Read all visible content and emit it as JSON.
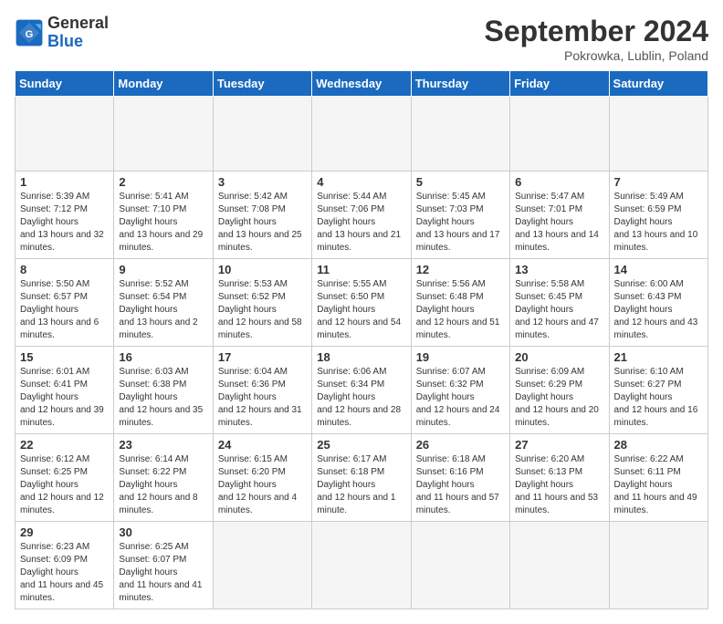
{
  "header": {
    "logo_general": "General",
    "logo_blue": "Blue",
    "month_title": "September 2024",
    "location": "Pokrowka, Lublin, Poland"
  },
  "calendar": {
    "days_of_week": [
      "Sunday",
      "Monday",
      "Tuesday",
      "Wednesday",
      "Thursday",
      "Friday",
      "Saturday"
    ],
    "weeks": [
      [
        {
          "day": "",
          "empty": true
        },
        {
          "day": "",
          "empty": true
        },
        {
          "day": "",
          "empty": true
        },
        {
          "day": "",
          "empty": true
        },
        {
          "day": "",
          "empty": true
        },
        {
          "day": "",
          "empty": true
        },
        {
          "day": "",
          "empty": true
        }
      ],
      [
        {
          "day": "1",
          "sunrise": "5:39 AM",
          "sunset": "7:12 PM",
          "daylight": "13 hours and 32 minutes."
        },
        {
          "day": "2",
          "sunrise": "5:41 AM",
          "sunset": "7:10 PM",
          "daylight": "13 hours and 29 minutes."
        },
        {
          "day": "3",
          "sunrise": "5:42 AM",
          "sunset": "7:08 PM",
          "daylight": "13 hours and 25 minutes."
        },
        {
          "day": "4",
          "sunrise": "5:44 AM",
          "sunset": "7:06 PM",
          "daylight": "13 hours and 21 minutes."
        },
        {
          "day": "5",
          "sunrise": "5:45 AM",
          "sunset": "7:03 PM",
          "daylight": "13 hours and 17 minutes."
        },
        {
          "day": "6",
          "sunrise": "5:47 AM",
          "sunset": "7:01 PM",
          "daylight": "13 hours and 14 minutes."
        },
        {
          "day": "7",
          "sunrise": "5:49 AM",
          "sunset": "6:59 PM",
          "daylight": "13 hours and 10 minutes."
        }
      ],
      [
        {
          "day": "8",
          "sunrise": "5:50 AM",
          "sunset": "6:57 PM",
          "daylight": "13 hours and 6 minutes."
        },
        {
          "day": "9",
          "sunrise": "5:52 AM",
          "sunset": "6:54 PM",
          "daylight": "13 hours and 2 minutes."
        },
        {
          "day": "10",
          "sunrise": "5:53 AM",
          "sunset": "6:52 PM",
          "daylight": "12 hours and 58 minutes."
        },
        {
          "day": "11",
          "sunrise": "5:55 AM",
          "sunset": "6:50 PM",
          "daylight": "12 hours and 54 minutes."
        },
        {
          "day": "12",
          "sunrise": "5:56 AM",
          "sunset": "6:48 PM",
          "daylight": "12 hours and 51 minutes."
        },
        {
          "day": "13",
          "sunrise": "5:58 AM",
          "sunset": "6:45 PM",
          "daylight": "12 hours and 47 minutes."
        },
        {
          "day": "14",
          "sunrise": "6:00 AM",
          "sunset": "6:43 PM",
          "daylight": "12 hours and 43 minutes."
        }
      ],
      [
        {
          "day": "15",
          "sunrise": "6:01 AM",
          "sunset": "6:41 PM",
          "daylight": "12 hours and 39 minutes."
        },
        {
          "day": "16",
          "sunrise": "6:03 AM",
          "sunset": "6:38 PM",
          "daylight": "12 hours and 35 minutes."
        },
        {
          "day": "17",
          "sunrise": "6:04 AM",
          "sunset": "6:36 PM",
          "daylight": "12 hours and 31 minutes."
        },
        {
          "day": "18",
          "sunrise": "6:06 AM",
          "sunset": "6:34 PM",
          "daylight": "12 hours and 28 minutes."
        },
        {
          "day": "19",
          "sunrise": "6:07 AM",
          "sunset": "6:32 PM",
          "daylight": "12 hours and 24 minutes."
        },
        {
          "day": "20",
          "sunrise": "6:09 AM",
          "sunset": "6:29 PM",
          "daylight": "12 hours and 20 minutes."
        },
        {
          "day": "21",
          "sunrise": "6:10 AM",
          "sunset": "6:27 PM",
          "daylight": "12 hours and 16 minutes."
        }
      ],
      [
        {
          "day": "22",
          "sunrise": "6:12 AM",
          "sunset": "6:25 PM",
          "daylight": "12 hours and 12 minutes."
        },
        {
          "day": "23",
          "sunrise": "6:14 AM",
          "sunset": "6:22 PM",
          "daylight": "12 hours and 8 minutes."
        },
        {
          "day": "24",
          "sunrise": "6:15 AM",
          "sunset": "6:20 PM",
          "daylight": "12 hours and 4 minutes."
        },
        {
          "day": "25",
          "sunrise": "6:17 AM",
          "sunset": "6:18 PM",
          "daylight": "12 hours and 1 minute."
        },
        {
          "day": "26",
          "sunrise": "6:18 AM",
          "sunset": "6:16 PM",
          "daylight": "11 hours and 57 minutes."
        },
        {
          "day": "27",
          "sunrise": "6:20 AM",
          "sunset": "6:13 PM",
          "daylight": "11 hours and 53 minutes."
        },
        {
          "day": "28",
          "sunrise": "6:22 AM",
          "sunset": "6:11 PM",
          "daylight": "11 hours and 49 minutes."
        }
      ],
      [
        {
          "day": "29",
          "sunrise": "6:23 AM",
          "sunset": "6:09 PM",
          "daylight": "11 hours and 45 minutes."
        },
        {
          "day": "30",
          "sunrise": "6:25 AM",
          "sunset": "6:07 PM",
          "daylight": "11 hours and 41 minutes."
        },
        {
          "day": "",
          "empty": true
        },
        {
          "day": "",
          "empty": true
        },
        {
          "day": "",
          "empty": true
        },
        {
          "day": "",
          "empty": true
        },
        {
          "day": "",
          "empty": true
        }
      ]
    ]
  },
  "labels": {
    "sunrise_label": "Sunrise:",
    "sunset_label": "Sunset:",
    "daylight_label": "Daylight:"
  }
}
